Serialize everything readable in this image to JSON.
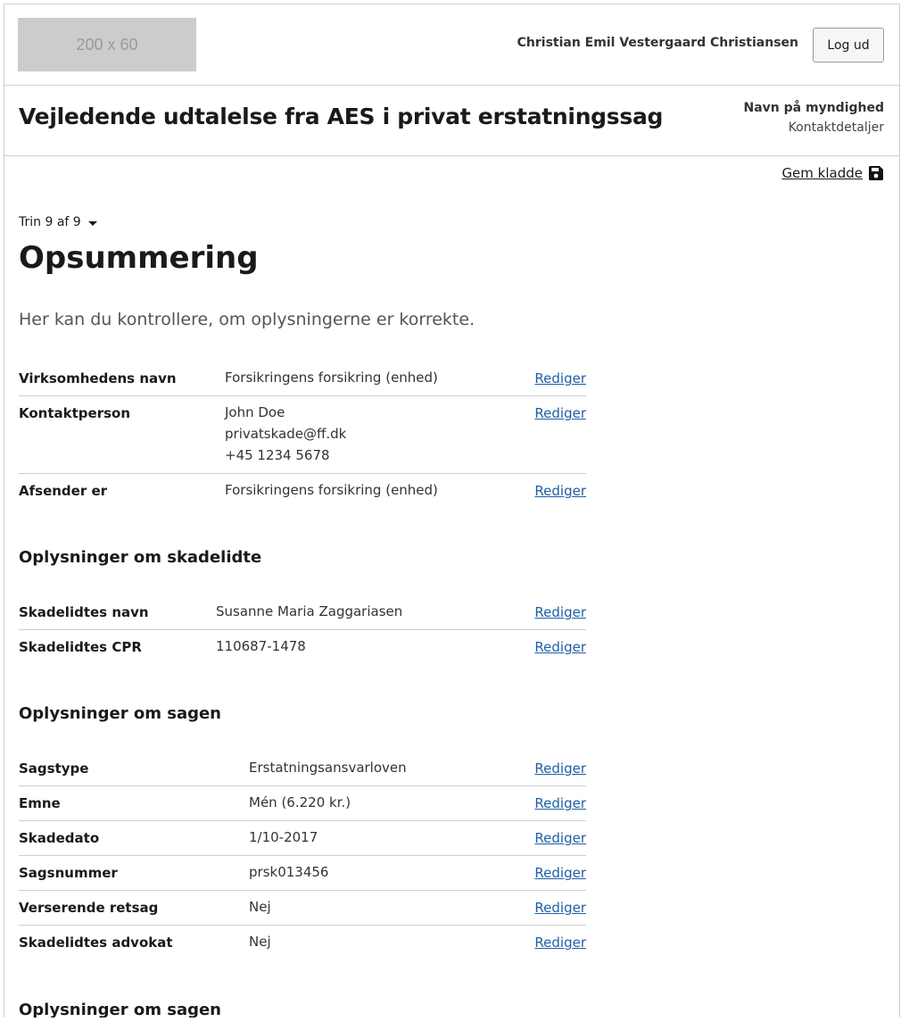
{
  "header": {
    "logo_text": "200 x 60",
    "user_name": "Christian Emil Vestergaard Christiansen",
    "logout_label": "Log ud"
  },
  "title_bar": {
    "title": "Vejledende udtalelse fra AES i privat erstatningssag",
    "authority_name": "Navn på myndighed",
    "authority_contact": "Kontaktdetaljer"
  },
  "draft": {
    "label": "Gem kladde",
    "icon": "save-icon"
  },
  "step": {
    "label": "Trin 9 af 9"
  },
  "page": {
    "heading": "Opsummering",
    "intro": "Her kan du kontrollere, om oplysningerne er korrekte."
  },
  "edit_label": "Rediger",
  "sender_rows": [
    {
      "key": "Virksomhedens navn",
      "values": [
        "Forsikringens forsikring (enhed)"
      ]
    },
    {
      "key": "Kontaktperson",
      "values": [
        "John Doe",
        "privatskade@ff.dk",
        "+45 1234 5678"
      ]
    },
    {
      "key": "Afsender er",
      "values": [
        "Forsikringens forsikring (enhed)"
      ]
    }
  ],
  "injured_section": {
    "heading": "Oplysninger om skadelidte",
    "rows": [
      {
        "key": "Skadelidtes navn",
        "values": [
          "Susanne Maria Zaggariasen"
        ]
      },
      {
        "key": "Skadelidtes CPR",
        "values": [
          "110687-1478"
        ]
      }
    ]
  },
  "case_section": {
    "heading": "Oplysninger om sagen",
    "rows": [
      {
        "key": "Sagstype",
        "values": [
          "Erstatningsansvarloven"
        ]
      },
      {
        "key": "Emne",
        "values": [
          "Mén (6.220 kr.)"
        ]
      },
      {
        "key": "Skadedato",
        "values": [
          "1/10-2017"
        ]
      },
      {
        "key": "Sagsnummer",
        "values": [
          "prsk013456"
        ]
      },
      {
        "key": "Verserende retsag",
        "values": [
          "Nej"
        ]
      },
      {
        "key": "Skadelidtes advokat",
        "values": [
          "Nej"
        ]
      }
    ]
  },
  "next_section": {
    "heading": "Oplysninger om sagen"
  },
  "colors": {
    "link": "#1f5fa6",
    "border": "#cfcfcf",
    "logo_bg": "#cccccc"
  }
}
